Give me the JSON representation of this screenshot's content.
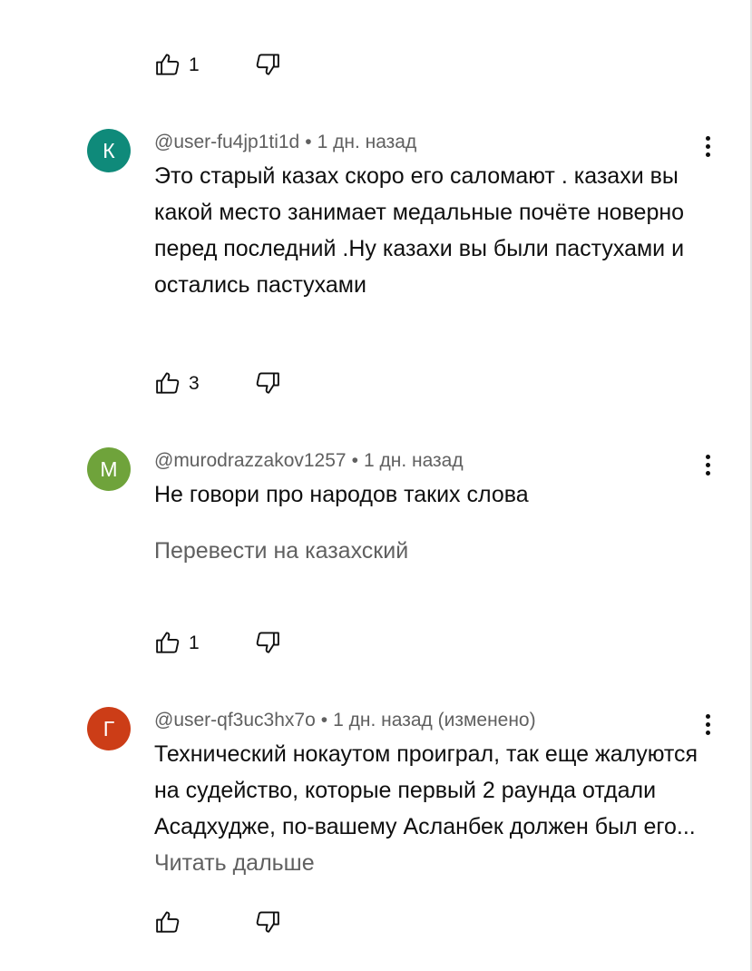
{
  "top_actions": {
    "like_count": "1"
  },
  "comments": [
    {
      "avatar_letter": "К",
      "avatar_color": "#0f8a7a",
      "username": "@user-fu4jp1ti1d",
      "time": "1 дн. назад",
      "text": "Это старый казах скоро его саломают . казахи вы какой место занимает медальные почёте новерно перед последний .Ну казахи вы были пастухами и остались пастухами",
      "like_count": "3"
    },
    {
      "avatar_letter": "M",
      "avatar_color": "#6fa33b",
      "username": "@murodrazzakov1257",
      "time": "1 дн. назад",
      "text": "Не говори про народов таких слова",
      "translate": "Перевести на казахский",
      "like_count": "1"
    },
    {
      "avatar_letter": "Г",
      "avatar_color": "#cc3d17",
      "username": "@user-qf3uc3hx7o",
      "time": "1 дн. назад (изменено)",
      "text": "Технический нокаутом проиграл, так еще жалуются на судейство, которые первый 2 раунда отдали Асадхудже, по-вашему Асланбек должен был его...",
      "read_more": "Читать дальше",
      "like_count": ""
    }
  ],
  "separator": "•",
  "colors": {
    "text": "#0f0f0f",
    "secondary": "#606060"
  }
}
